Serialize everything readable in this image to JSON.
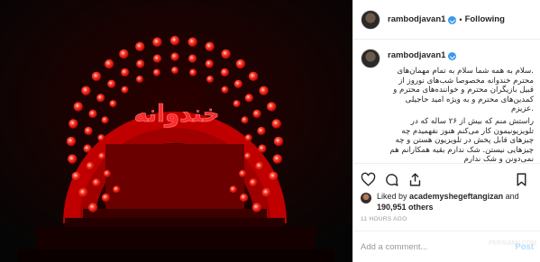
{
  "post": {
    "image_logo_text": "خندوانه"
  },
  "header": {
    "username": "rambodjavan1",
    "separator": "•",
    "follow_label": "Following"
  },
  "caption": {
    "username": "rambodjavan1",
    "paragraph1": ".سلام به همه شما\nسلام به تمام مهمان‌های محترم خندوانه مخصوصا شب‌های نوروز از قبیل بازیگران محترم و خواننده‌های محترم و کمدین‌های محترم و به ویژه امید حاجیلی .عزیزم",
    "paragraph2": "راستش منم که بیش از ۲۶ ساله که در تلویزیونیمون کار می‌کنم هنوز نفهمیدم چه چیزهای قابل پخش در تلویزیون هستن و چه چیزهایی نیستن. شک ندارم بقیه همکارانم هم نمی‌دونن و شک ندارم"
  },
  "actions": {
    "like_icon": "heart-icon",
    "comment_icon": "comment-icon",
    "share_icon": "share-icon",
    "save_icon": "bookmark-icon"
  },
  "likes": {
    "prefix": "Liked by ",
    "user": "academyshegeftangizan",
    "and": " and",
    "count": "190,951 others"
  },
  "time": "11 HOURS AGO",
  "comment_box": {
    "placeholder": "Add a comment...",
    "post_label": "Post"
  },
  "watermark": "PERSIANV.COM"
}
